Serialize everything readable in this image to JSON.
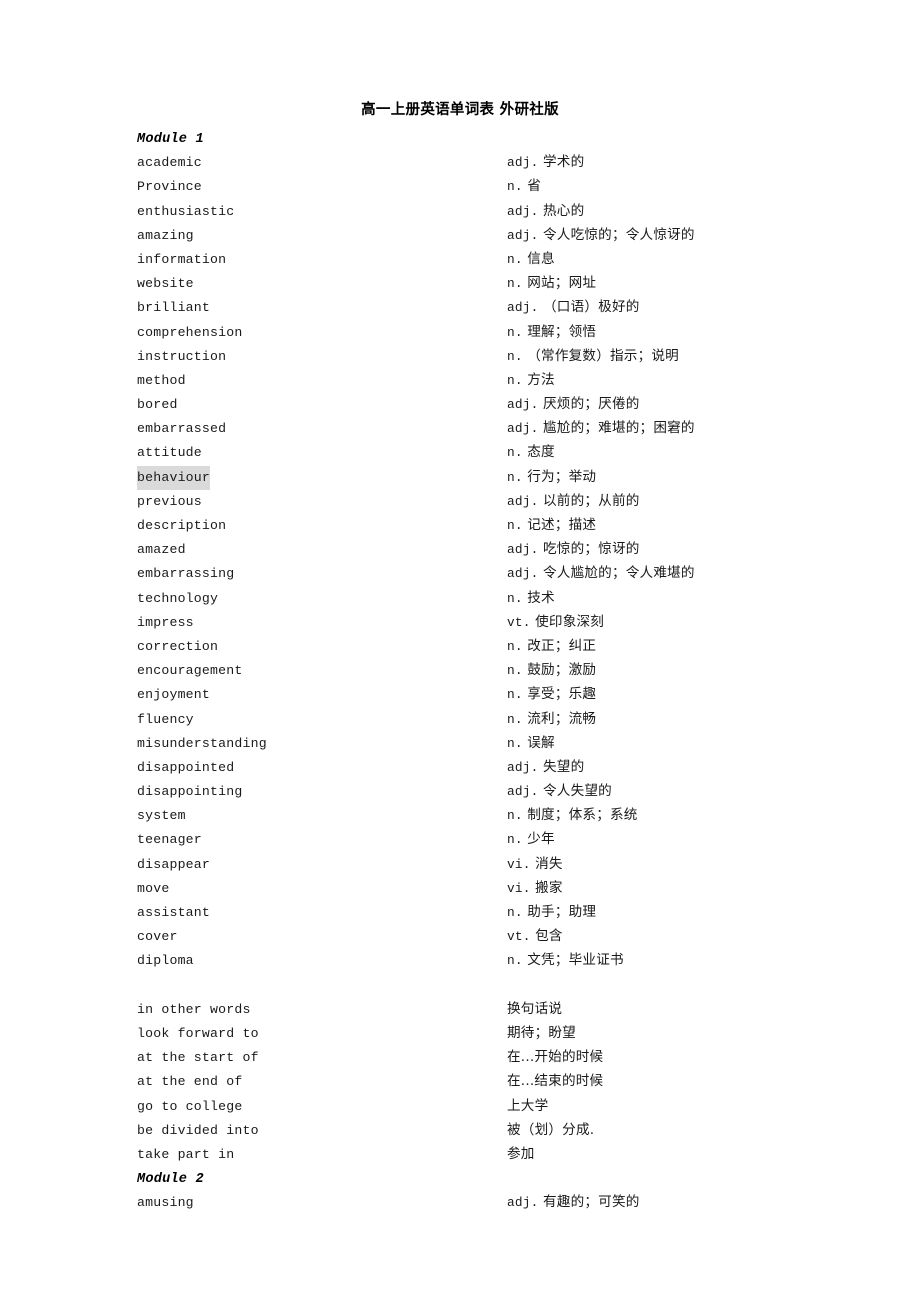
{
  "document": {
    "title": "高一上册英语单词表 外研社版"
  },
  "entries": [
    {
      "kind": "module",
      "term": "Module 1",
      "pos": "",
      "zh": ""
    },
    {
      "kind": "word",
      "term": "academic",
      "pos": "adj.",
      "zh": "学术的"
    },
    {
      "kind": "word",
      "term": "Province",
      "pos": "n.",
      "zh": "省"
    },
    {
      "kind": "word",
      "term": "enthusiastic",
      "pos": "adj.",
      "zh": "热心的"
    },
    {
      "kind": "word",
      "term": "amazing",
      "pos": "adj.",
      "zh": "令人吃惊的；令人惊讶的"
    },
    {
      "kind": "word",
      "term": "information",
      "pos": "n.",
      "zh": "信息"
    },
    {
      "kind": "word",
      "term": "website",
      "pos": "n.",
      "zh": "网站；网址"
    },
    {
      "kind": "word",
      "term": "brilliant",
      "pos": "adj.",
      "zh": "（口语）极好的"
    },
    {
      "kind": "word",
      "term": "comprehension",
      "pos": "n.",
      "zh": "理解；领悟"
    },
    {
      "kind": "word",
      "term": "instruction",
      "pos": "n.",
      "zh": "（常作复数）指示；说明"
    },
    {
      "kind": "word",
      "term": "method",
      "pos": "n.",
      "zh": "方法"
    },
    {
      "kind": "word",
      "term": "bored",
      "pos": "adj.",
      "zh": "厌烦的；厌倦的"
    },
    {
      "kind": "word",
      "term": "embarrassed",
      "pos": "adj.",
      "zh": "尴尬的；难堪的；困窘的"
    },
    {
      "kind": "word",
      "term": "attitude",
      "pos": "n.",
      "zh": "态度"
    },
    {
      "kind": "word",
      "term": "behaviour",
      "pos": "n.",
      "zh": "行为；举动",
      "highlight": true
    },
    {
      "kind": "word",
      "term": "previous",
      "pos": "adj.",
      "zh": "以前的；从前的"
    },
    {
      "kind": "word",
      "term": "description",
      "pos": "n.",
      "zh": "记述；描述"
    },
    {
      "kind": "word",
      "term": "amazed",
      "pos": "adj.",
      "zh": "吃惊的；惊讶的"
    },
    {
      "kind": "word",
      "term": "embarrassing",
      "pos": "adj.",
      "zh": "令人尴尬的；令人难堪的"
    },
    {
      "kind": "word",
      "term": "technology",
      "pos": "n.",
      "zh": "技术"
    },
    {
      "kind": "word",
      "term": "impress",
      "pos": "vt.",
      "zh": "使印象深刻"
    },
    {
      "kind": "word",
      "term": "correction",
      "pos": "n.",
      "zh": "改正；纠正"
    },
    {
      "kind": "word",
      "term": "encouragement",
      "pos": "n.",
      "zh": "鼓励；激励"
    },
    {
      "kind": "word",
      "term": "enjoyment",
      "pos": "n.",
      "zh": "享受；乐趣"
    },
    {
      "kind": "word",
      "term": "fluency",
      "pos": "n.",
      "zh": "流利；流畅"
    },
    {
      "kind": "word",
      "term": "misunderstanding",
      "pos": "n.",
      "zh": "误解"
    },
    {
      "kind": "word",
      "term": "disappointed",
      "pos": "adj.",
      "zh": "失望的"
    },
    {
      "kind": "word",
      "term": "disappointing",
      "pos": "adj.",
      "zh": "令人失望的"
    },
    {
      "kind": "word",
      "term": "system",
      "pos": "n.",
      "zh": "制度；体系；系统"
    },
    {
      "kind": "word",
      "term": "teenager",
      "pos": "n.",
      "zh": "少年"
    },
    {
      "kind": "word",
      "term": "disappear",
      "pos": "vi.",
      "zh": "消失"
    },
    {
      "kind": "word",
      "term": "move",
      "pos": "vi.",
      "zh": "搬家"
    },
    {
      "kind": "word",
      "term": "assistant",
      "pos": "n.",
      "zh": "助手；助理"
    },
    {
      "kind": "word",
      "term": "cover",
      "pos": "vt.",
      "zh": "包含"
    },
    {
      "kind": "word",
      "term": "diploma",
      "pos": "n.",
      "zh": "文凭；毕业证书"
    },
    {
      "kind": "blank",
      "term": "",
      "pos": "",
      "zh": ""
    },
    {
      "kind": "phrase",
      "term": "in other words",
      "pos": "",
      "zh": "换句话说"
    },
    {
      "kind": "phrase",
      "term": "look forward to",
      "pos": "",
      "zh": "期待；盼望"
    },
    {
      "kind": "phrase",
      "term": "at the start of",
      "pos": "",
      "zh": "在...开始的时候"
    },
    {
      "kind": "phrase",
      "term": "at the end of",
      "pos": "",
      "zh": "在...结束的时候"
    },
    {
      "kind": "phrase",
      "term": "go to college",
      "pos": "",
      "zh": "上大学"
    },
    {
      "kind": "phrase",
      "term": "be divided into",
      "pos": "",
      "zh": "被（划）分成."
    },
    {
      "kind": "phrase",
      "term": "take part in",
      "pos": "",
      "zh": "参加"
    },
    {
      "kind": "module",
      "term": "Module 2",
      "pos": "",
      "zh": ""
    },
    {
      "kind": "word",
      "term": "amusing",
      "pos": "adj.",
      "zh": "有趣的；可笑的"
    }
  ],
  "colors": {
    "page_background": "#ffffff",
    "text": "#1a1a1a",
    "highlight": "#dadada"
  }
}
